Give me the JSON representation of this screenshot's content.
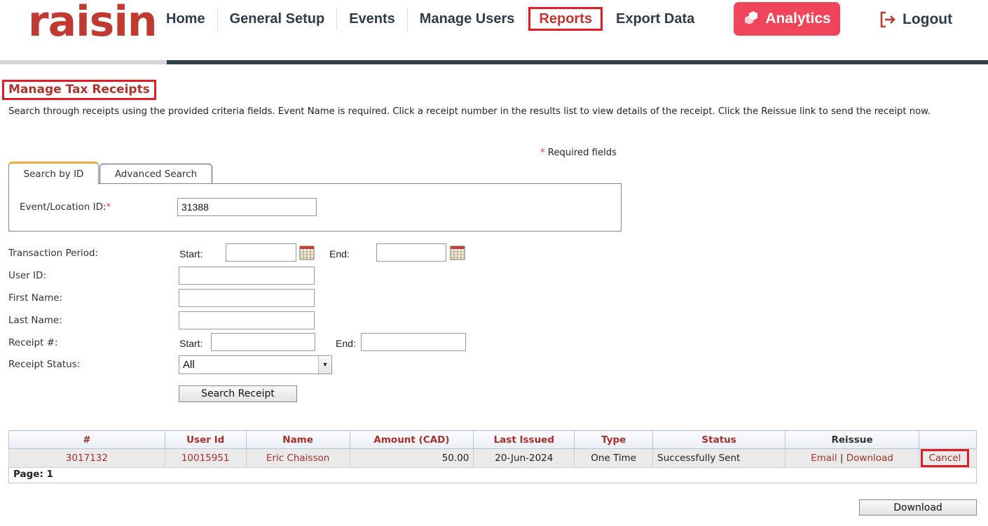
{
  "brand": {
    "logo_text": "raisin",
    "logo_color": "#c13a32",
    "analytics_color": "#f0445b",
    "accent_red": "#e01c25"
  },
  "nav": {
    "items": [
      {
        "label": "Home"
      },
      {
        "label": "General Setup"
      },
      {
        "label": "Events"
      },
      {
        "label": "Manage Users"
      },
      {
        "label": "Reports",
        "active": true
      },
      {
        "label": "Export Data"
      }
    ],
    "analytics_label": "Analytics",
    "analytics_icon": "hexagon-icon",
    "logout_label": "Logout",
    "logout_icon": "logout-icon"
  },
  "page": {
    "title": "Manage Tax Receipts",
    "intro": "Search through receipts using the provided criteria fields. Event Name is required. Click a receipt number in the results list to view details of the receipt. Click the Reissue link to send the receipt now.",
    "required_mark": "*",
    "required_note": "Required fields"
  },
  "tabs": {
    "search_by_id": "Search by ID",
    "advanced_search": "Advanced Search"
  },
  "form": {
    "event_label": "Event/Location ID:",
    "event_value": "31388",
    "transaction_period_label": "Transaction Period:",
    "start_label": "Start:",
    "end_label": "End:",
    "transaction_start": "",
    "transaction_end": "",
    "user_id_label": "User ID:",
    "user_id_value": "",
    "first_name_label": "First Name:",
    "first_name_value": "",
    "last_name_label": "Last Name:",
    "last_name_value": "",
    "receipt_label": "Receipt #:",
    "receipt_start": "",
    "receipt_end": "",
    "status_label": "Receipt Status:",
    "status_value": "All",
    "search_button": "Search Receipt",
    "calendar_icon": "calendar-icon"
  },
  "results": {
    "columns": [
      "#",
      "User Id",
      "Name",
      "Amount (CAD)",
      "Last Issued",
      "Type",
      "Status",
      "Reissue",
      ""
    ],
    "rows": [
      {
        "receipt": "3017132",
        "user_id": "10015951",
        "name": "Eric Chaisson",
        "amount": "50.00",
        "last_issued": "20-Jun-2024",
        "type": "One Time",
        "status": "Successfully Sent",
        "reissue_email": "Email",
        "reissue_sep": "|",
        "reissue_download": "Download",
        "cancel": "Cancel"
      }
    ],
    "page_label": "Page: 1"
  },
  "download_button": "Download"
}
